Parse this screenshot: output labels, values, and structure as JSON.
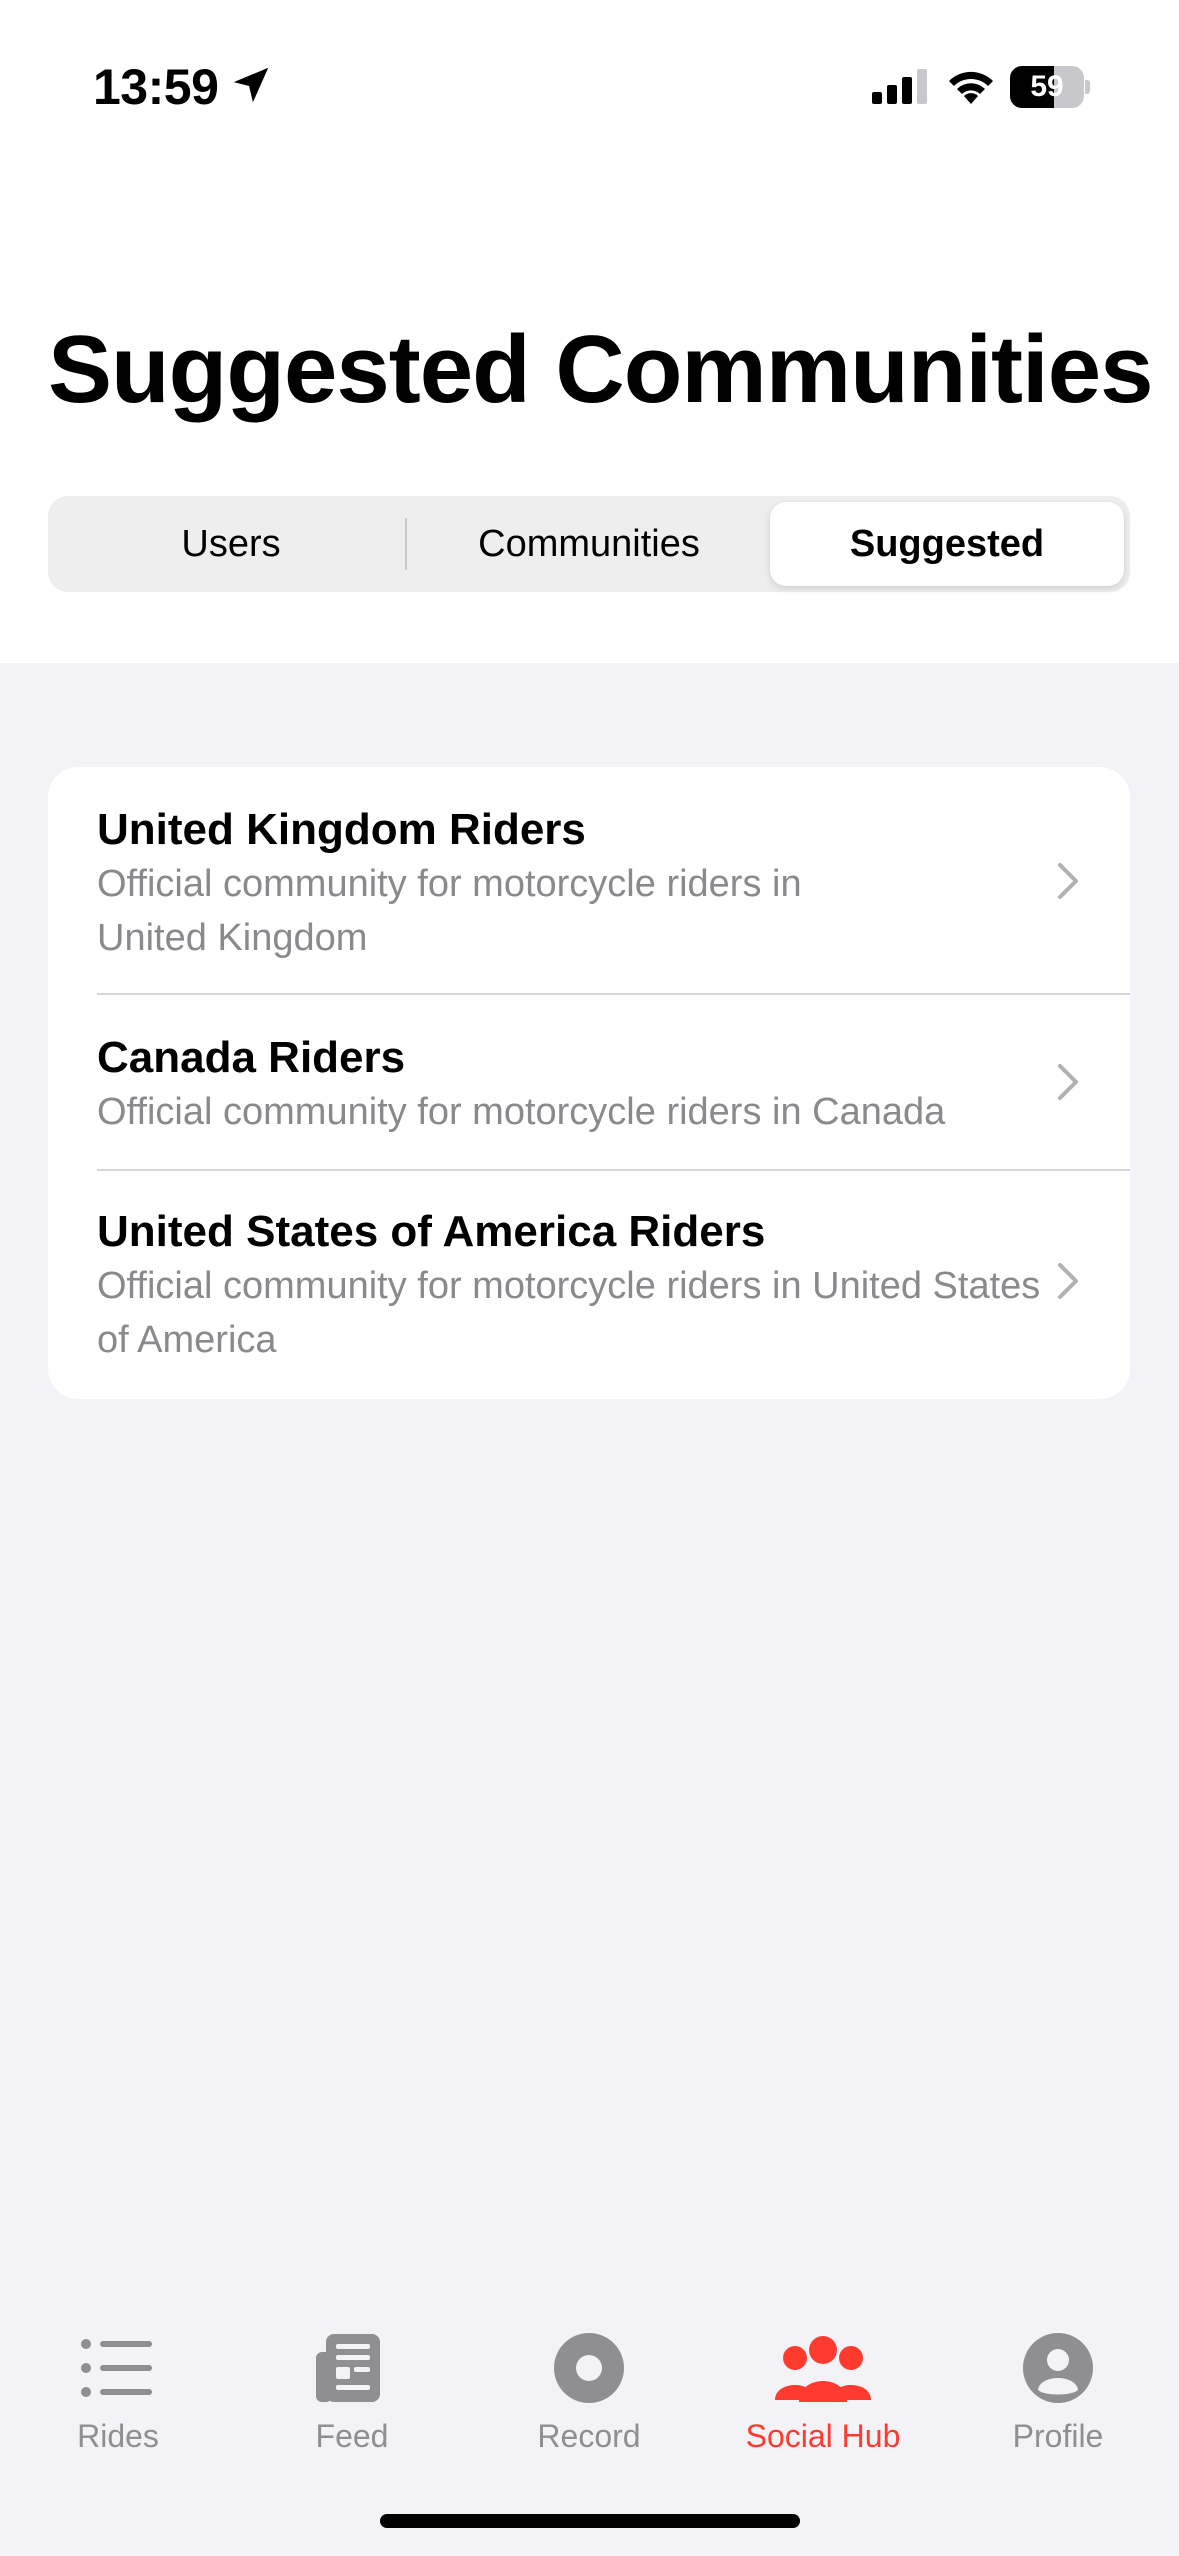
{
  "status_bar": {
    "time": "13:59",
    "battery": "59",
    "battery_level": 0.59
  },
  "page": {
    "title": "Suggested Communities"
  },
  "segmented_control": {
    "items": [
      "Users",
      "Communities",
      "Suggested"
    ],
    "selected": "Suggested"
  },
  "communities": [
    {
      "title": "United Kingdom Riders",
      "subtitle": "Official community for motorcycle riders in United Kingdom"
    },
    {
      "title": "Canada Riders",
      "subtitle": "Official community for motorcycle riders in Canada"
    },
    {
      "title": "United States of America Riders",
      "subtitle": "Official community for motorcycle riders in United States of America"
    }
  ],
  "tab_bar": {
    "items": [
      {
        "label": "Rides",
        "icon": "list-icon"
      },
      {
        "label": "Feed",
        "icon": "newspaper-icon"
      },
      {
        "label": "Record",
        "icon": "record-icon"
      },
      {
        "label": "Social Hub",
        "icon": "people-icon"
      },
      {
        "label": "Profile",
        "icon": "person-circle-icon"
      }
    ],
    "active": "Social Hub"
  },
  "colors": {
    "accent": "#ff3b30",
    "inactive": "#8e8e93",
    "background": "#f2f2f7",
    "card": "#ffffff",
    "subtitle": "#8a8a8e"
  }
}
